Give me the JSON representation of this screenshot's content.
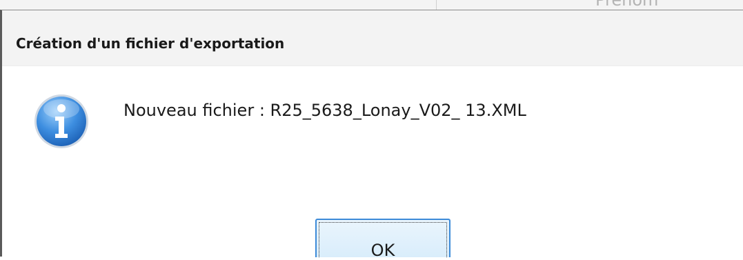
{
  "background": {
    "partial_text": "Prénom"
  },
  "dialog": {
    "title": "Création d'un fichier d'exportation",
    "icon": "info-icon",
    "message": "Nouveau fichier : R25_5638_Lonay_V02_ 13.XML",
    "ok_label": "OK"
  },
  "colors": {
    "icon_blue": "#2f7fd6",
    "button_border": "#3c8ad8",
    "button_fill": "#d9edfb",
    "titlebar_bg": "#f3f3f3"
  }
}
